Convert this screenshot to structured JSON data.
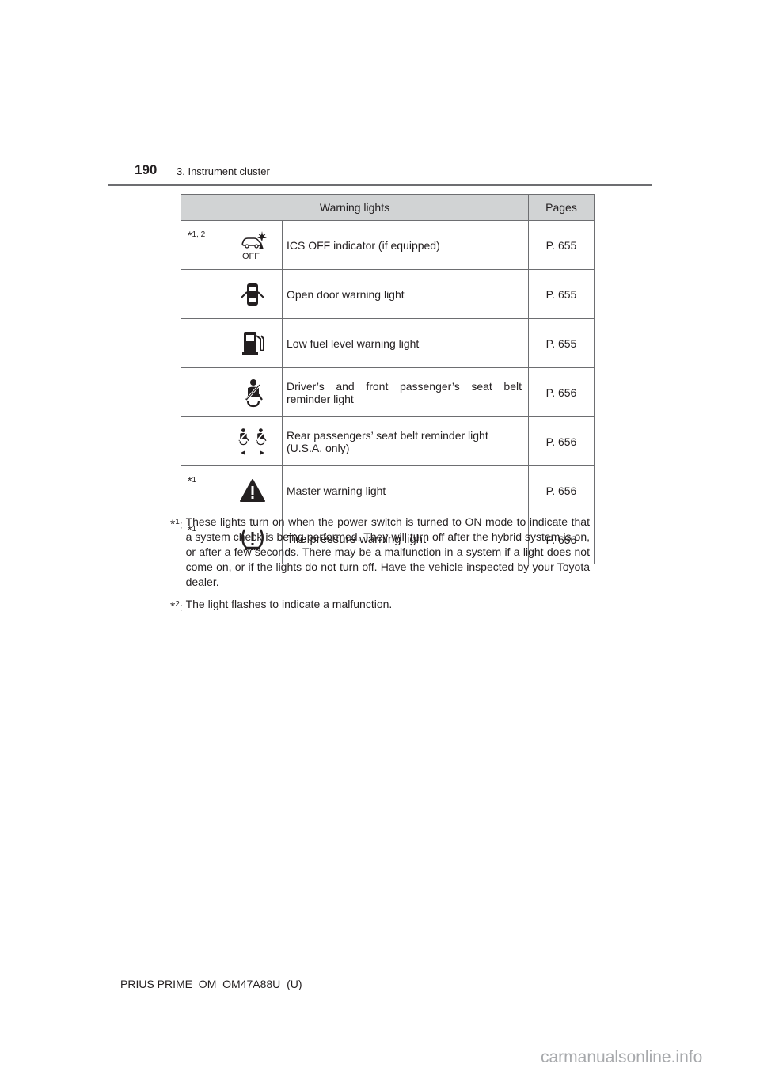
{
  "header": {
    "page_number": "190",
    "section": "3. Instrument cluster"
  },
  "table": {
    "col_warning_lights": "Warning lights",
    "col_pages": "Pages",
    "rows": [
      {
        "note": "1, 2",
        "icon": "ics-off-icon",
        "label": "ICS OFF indicator (if equipped)",
        "page": "P. 655"
      },
      {
        "note": "",
        "icon": "open-door-icon",
        "label": "Open door warning light",
        "page": "P. 655"
      },
      {
        "note": "",
        "icon": "low-fuel-icon",
        "label": "Low fuel level warning light",
        "page": "P. 655"
      },
      {
        "note": "",
        "icon": "seat-belt-icon",
        "label": "Driver’s and front passenger’s seat belt reminder light",
        "page": "P. 656"
      },
      {
        "note": "",
        "icon": "rear-seat-belt-icon",
        "label": "Rear passengers’ seat belt reminder light (U.S.A. only)",
        "page": "P. 656"
      },
      {
        "note": "1",
        "icon": "master-warning-icon",
        "label": "Master warning light",
        "page": "P. 656"
      },
      {
        "note": "1",
        "icon": "tire-pressure-icon",
        "label": "Tire pressure warning light",
        "page": "P. 656"
      }
    ],
    "ics_off_text": "OFF",
    "star": "*"
  },
  "footnotes": [
    {
      "mark": "1",
      "text": "These lights turn on when the power switch is turned to ON mode to indicate that a system check is being performed. They will turn off after the hybrid system is on, or after a few seconds. There may be a malfunction in a system if a light does not come on, or if the lights do not turn off. Have the vehicle inspected by your Toyota dealer."
    },
    {
      "mark": "2",
      "text": "The light flashes to indicate a malfunction."
    }
  ],
  "footer": {
    "doc_id": "PRIUS PRIME_OM_OM47A88U_(U)",
    "watermark": "carmanualsonline.info"
  }
}
